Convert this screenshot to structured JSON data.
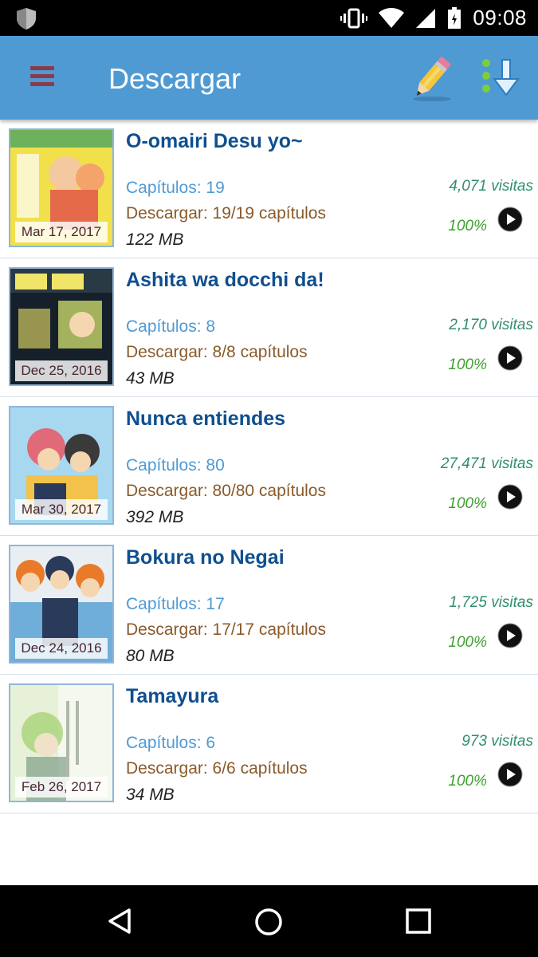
{
  "status_bar": {
    "time": "09:08",
    "icons": [
      "shield-icon",
      "vibrate-icon",
      "wifi-icon",
      "signal-icon",
      "battery-icon"
    ]
  },
  "app_bar": {
    "title": "Descargar",
    "icons": [
      "menu-icon",
      "pencil-icon",
      "download-list-icon"
    ]
  },
  "list": [
    {
      "title": "O-omairi Desu yo~",
      "date": "Mar 17, 2017",
      "chapters": "Capítulos: 19",
      "download": "Descargar: 19/19 capítulos",
      "size": "122 MB",
      "visits": "4,071 visitas",
      "progress": "100%",
      "cover_colors": [
        "#f1e04a",
        "#6fb15a",
        "#f4a46a"
      ]
    },
    {
      "title": "Ashita wa docchi da!",
      "date": "Dec 25, 2016",
      "chapters": "Capítulos: 8",
      "download": "Descargar: 8/8 capítulos",
      "size": "43 MB",
      "visits": "2,170 visitas",
      "progress": "100%",
      "cover_colors": [
        "#15202a",
        "#f0e56a",
        "#c8d66a"
      ]
    },
    {
      "title": "Nunca entiendes",
      "date": "Mar 30, 2017",
      "chapters": "Capítulos: 80",
      "download": "Descargar: 80/80 capítulos",
      "size": "392 MB",
      "visits": "27,471 visitas",
      "progress": "100%",
      "cover_colors": [
        "#a8d8ef",
        "#e06a7a",
        "#f3c24a"
      ]
    },
    {
      "title": "Bokura no Negai",
      "date": "Dec 24, 2016",
      "chapters": "Capítulos: 17",
      "download": "Descargar: 17/17 capítulos",
      "size": "80 MB",
      "visits": "1,725 visitas",
      "progress": "100%",
      "cover_colors": [
        "#6faed8",
        "#e87a2a",
        "#2a3a5a"
      ]
    },
    {
      "title": "Tamayura",
      "date": "Feb 26, 2017",
      "chapters": "Capítulos: 6",
      "download": "Descargar: 6/6 capítulos",
      "size": "34 MB",
      "visits": "973 visitas",
      "progress": "100%",
      "cover_colors": [
        "#e6f1d8",
        "#9fcf6a",
        "#6a8f7a"
      ]
    }
  ],
  "nav_bar": {
    "icons": [
      "back-icon",
      "home-icon",
      "recents-icon"
    ]
  }
}
